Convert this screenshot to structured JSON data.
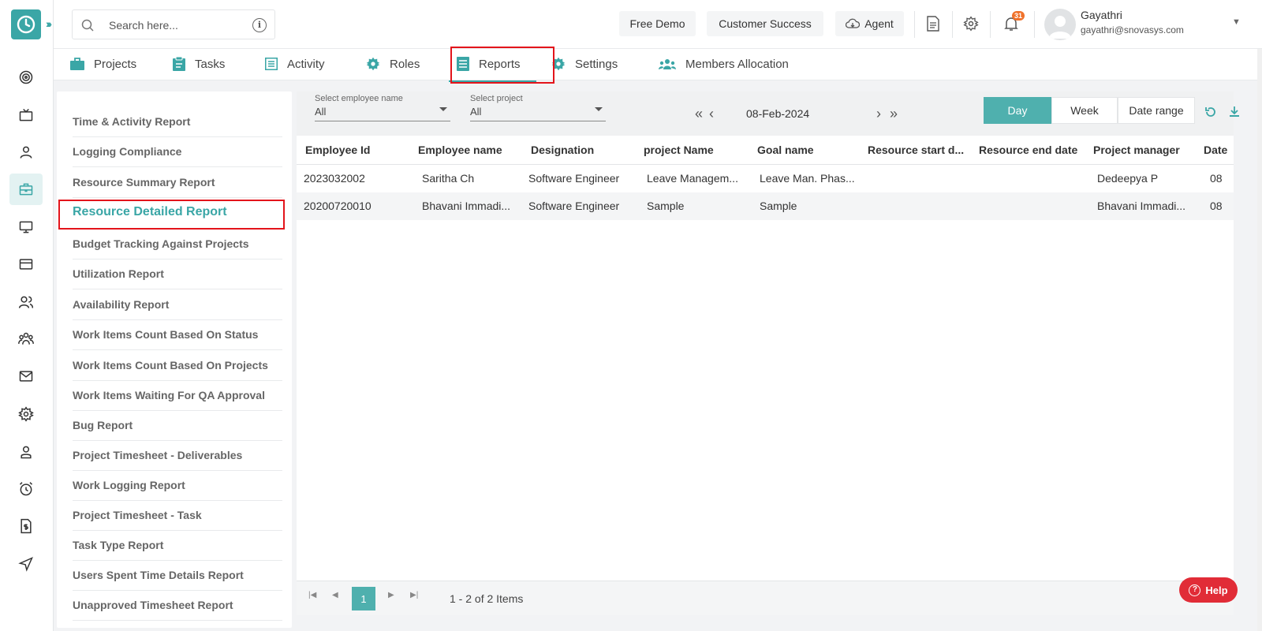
{
  "search": {
    "placeholder": "Search here..."
  },
  "topbar": {
    "free_demo": "Free Demo",
    "customer_success": "Customer Success",
    "agent": "Agent",
    "notification_count": "31",
    "user_name": "Gayathri",
    "user_email": "gayathri@snovasys.com"
  },
  "tabs": [
    {
      "label": "Projects",
      "icon": "briefcase-icon"
    },
    {
      "label": "Tasks",
      "icon": "clipboard-icon"
    },
    {
      "label": "Activity",
      "icon": "list-icon"
    },
    {
      "label": "Roles",
      "icon": "gear-icon"
    },
    {
      "label": "Reports",
      "icon": "document-icon",
      "active": true
    },
    {
      "label": "Settings",
      "icon": "gear-icon"
    },
    {
      "label": "Members Allocation",
      "icon": "people-icon"
    }
  ],
  "reports": [
    "Time & Activity Report",
    "Logging Compliance",
    "Resource Summary Report",
    "Resource Detailed Report",
    "Budget Tracking Against Projects",
    "Utilization Report",
    "Availability Report",
    "Work Items Count Based On Status",
    "Work Items Count Based On Projects",
    "Work Items Waiting For QA Approval",
    "Bug Report",
    "Project Timesheet - Deliverables",
    "Work Logging Report",
    "Project Timesheet - Task",
    "Task Type Report",
    "Users Spent Time Details Report",
    "Unapproved Timesheet Report"
  ],
  "active_report": "Resource Detailed Report",
  "filters": {
    "employee": {
      "label": "Select employee name",
      "value": "All"
    },
    "project": {
      "label": "Select project",
      "value": "All"
    },
    "date": "08-Feb-2024",
    "range_options": [
      "Day",
      "Week",
      "Date range"
    ],
    "range_selected": "Day"
  },
  "table": {
    "columns": [
      "Employee Id",
      "Employee name",
      "Designation",
      "project Name",
      "Goal name",
      "Resource start d...",
      "Resource end date",
      "Project manager",
      "Date"
    ],
    "rows": [
      [
        "2023032002",
        "Saritha Ch",
        "Software Engineer",
        "Leave Managem...",
        "Leave Man. Phas...",
        "",
        "",
        "Dedeepya P",
        "08"
      ],
      [
        "20200720010",
        "Bhavani Immadi...",
        "Software Engineer",
        "Sample",
        "Sample",
        "",
        "",
        "Bhavani Immadi...",
        "08"
      ]
    ]
  },
  "pager": {
    "current_page": "1",
    "info": "1 - 2 of 2 Items"
  },
  "help": {
    "label": "Help"
  },
  "colors": {
    "accent": "#3aa6a6",
    "highlight": "#e3141b",
    "help": "#e12c37"
  }
}
